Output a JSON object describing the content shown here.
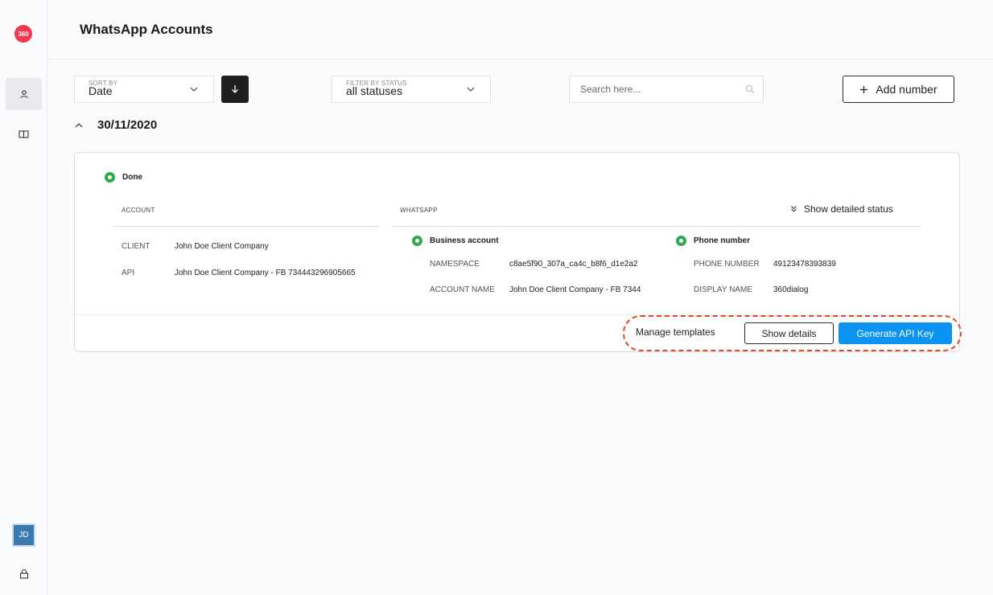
{
  "sidebar": {
    "logo_text": "360",
    "items": [
      {
        "icon": "user-icon",
        "active": true
      },
      {
        "icon": "book-icon",
        "active": false
      }
    ],
    "avatar_initials": "JD",
    "lock_icon": "lock-icon"
  },
  "header": {
    "title": "WhatsApp Accounts"
  },
  "toolbar": {
    "sort": {
      "label": "SORT BY",
      "value": "Date"
    },
    "sort_direction_icon": "arrow-down-icon",
    "filter": {
      "label": "FILTER BY STATUS",
      "value": "all statuses"
    },
    "search": {
      "placeholder": "Search here..."
    },
    "add_button": "Add number"
  },
  "group": {
    "date": "30/11/2020"
  },
  "card": {
    "status": "Done",
    "account": {
      "heading": "ACCOUNT",
      "rows": [
        {
          "key": "CLIENT",
          "value": "John Doe Client Company"
        },
        {
          "key": "API",
          "value": "John Doe Client Company - FB 734443296905665"
        }
      ]
    },
    "whatsapp": {
      "heading": "WHATSAPP",
      "show_status": "Show detailed status",
      "business": {
        "title": "Business account",
        "rows": [
          {
            "key": "NAMESPACE",
            "value": "c8ae5f90_307a_ca4c_b8f6_d1e2a2"
          },
          {
            "key": "ACCOUNT NAME",
            "value": "John Doe Client Company - FB 7344"
          }
        ]
      },
      "phone": {
        "title": "Phone number",
        "rows": [
          {
            "key": "PHONE NUMBER",
            "value": "49123478393839"
          },
          {
            "key": "DISPLAY NAME",
            "value": "360dialog"
          }
        ]
      }
    },
    "actions": {
      "manage": "Manage templates",
      "details": "Show details",
      "api": "Generate API Key"
    }
  },
  "colors": {
    "accent": "#0a93f0",
    "status_green": "#2ea84f",
    "highlight": "#e24a1c",
    "logo": "#f1384d"
  }
}
